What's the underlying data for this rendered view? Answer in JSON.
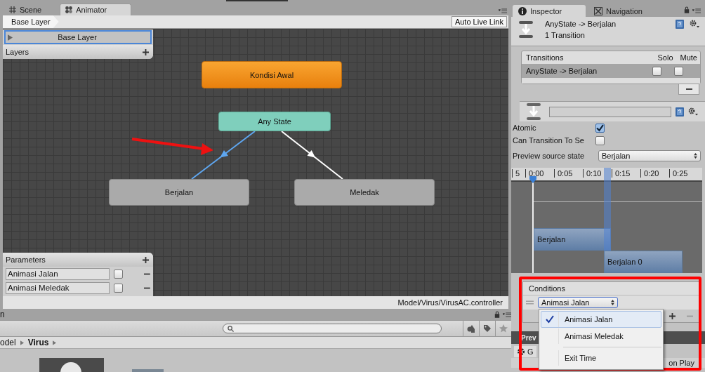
{
  "left_tabs": [
    {
      "label": "Scene",
      "kind": "scene",
      "selected": false
    },
    {
      "label": "Animator",
      "kind": "animator",
      "selected": true
    }
  ],
  "breadcrumb": "Base Layer",
  "auto_live_link": "Auto Live Link",
  "layers": {
    "title": "Layers",
    "items": [
      {
        "name": "Base Layer",
        "selected": true
      }
    ]
  },
  "graph": {
    "nodes": [
      {
        "label": "Kondisi Awal",
        "kind": "entry"
      },
      {
        "label": "Any State",
        "kind": "any"
      },
      {
        "label": "Berjalan",
        "kind": "state"
      },
      {
        "label": "Meledak",
        "kind": "state"
      }
    ],
    "transitions": [
      {
        "selected": true
      },
      {
        "selected": false
      }
    ]
  },
  "parameters": {
    "title": "Parameters",
    "items": [
      {
        "name": "Animasi Jalan",
        "checked": false
      },
      {
        "name": "Animasi Meledak",
        "checked": false
      }
    ]
  },
  "controller_path": "Model/Virus/VirusAC.controller",
  "project": {
    "title": "n",
    "breadcrumb": [
      {
        "label": "odel",
        "bold": false
      },
      {
        "label": "Virus",
        "bold": true
      }
    ]
  },
  "inspector": {
    "tabs": [
      {
        "label": "Inspector",
        "kind": "inspector",
        "selected": true
      },
      {
        "label": "Navigation",
        "kind": "navigation",
        "selected": false
      }
    ],
    "title": "AnyState -> Berjalan",
    "subtitle": "1 Transition",
    "transitions": {
      "header": "Transitions",
      "solo": "Solo",
      "mute": "Mute",
      "rows": [
        {
          "name": "AnyState -> Berjalan",
          "selected": true,
          "solo": false,
          "mute": false
        }
      ]
    },
    "toggles": [
      {
        "label": "Atomic",
        "checked": true
      },
      {
        "label": "Can Transition To Se",
        "checked": false
      }
    ],
    "preview_source": {
      "label": "Preview source state",
      "value": "Berjalan"
    },
    "timeline": {
      "ticks": [
        "5",
        "0:00",
        "0:05",
        "0:10",
        "0:15",
        "0:20",
        "0:25"
      ],
      "clips": [
        "Berjalan",
        "Berjalan 0"
      ]
    },
    "conditions": {
      "title": "Conditions",
      "rows": [
        {
          "parameter": "Animasi Jalan"
        }
      ]
    },
    "menu": [
      {
        "label": "Animasi Jalan",
        "kind": "parameter",
        "selected": true
      },
      {
        "label": "Animasi Meledak",
        "kind": "parameter",
        "selected": false
      },
      {
        "label": "Exit Time",
        "kind": "exit_time",
        "selected": false
      }
    ],
    "preview": {
      "title": "Prev",
      "tab": "G",
      "status": "on Play"
    }
  }
}
